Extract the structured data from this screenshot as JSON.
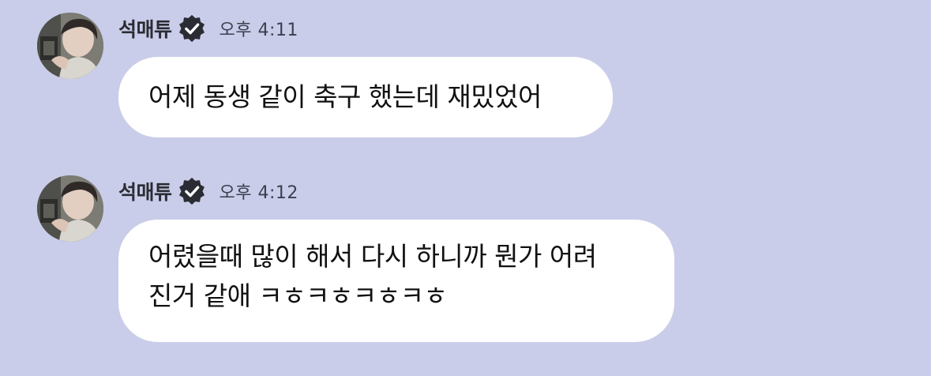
{
  "colors": {
    "background": "#c9cde9",
    "bubble": "#ffffff",
    "badge": "#2b2b33"
  },
  "messages": [
    {
      "sender": "석매튜",
      "verified_icon": "verified-badge-icon",
      "time": "오후 4:11",
      "lines": [
        "어제 동생 같이 축구 했는데 재밌었어"
      ]
    },
    {
      "sender": "석매튜",
      "verified_icon": "verified-badge-icon",
      "time": "오후 4:12",
      "lines": [
        "어렸을때 많이 해서 다시 하니까 뭔가 어려",
        "진거 같애 ㅋㅎㅋㅎㅋㅎㅋㅎ"
      ]
    }
  ]
}
